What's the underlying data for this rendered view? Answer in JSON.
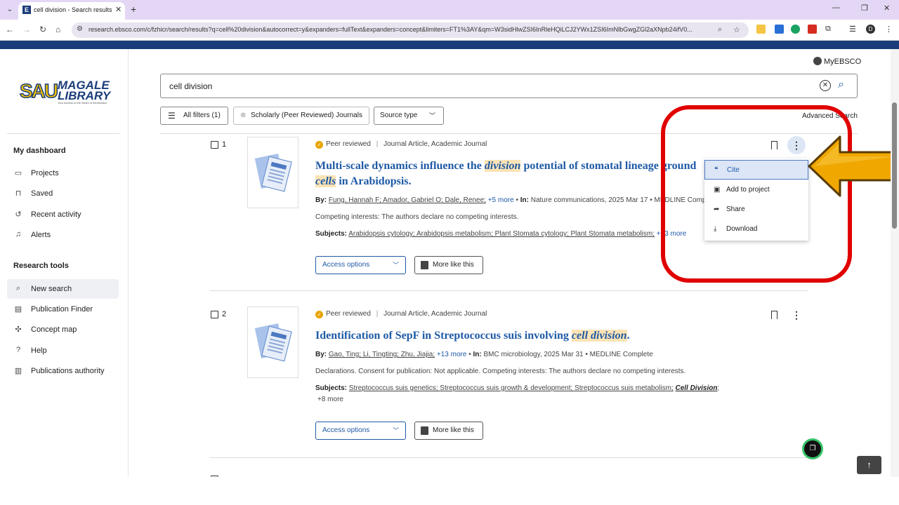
{
  "browser": {
    "tab_title": "cell division - Search results - E",
    "tab_favicon": "E",
    "url": "research.ebsco.com/c/fzhicr/search/results?q=cell%20division&autocorrect=y&expanders=fullText&expanders=concept&limiters=FT1%3AY&qm=W3sidHlwZSI6InRleHQiLCJ2YWx1ZSI6ImNlbGwgZGl2aXNpb24ifV0...",
    "profile_initial": "D"
  },
  "sidebar": {
    "logo_sau": "SAU",
    "logo_top": "MAGALE",
    "logo_bottom": "LIBRARY",
    "logo_tagline": "Your Access to the World of Information",
    "dashboard_heading": "My dashboard",
    "dashboard_items": [
      {
        "label": "Projects",
        "icon": "folder-icon"
      },
      {
        "label": "Saved",
        "icon": "bookmark-icon"
      },
      {
        "label": "Recent activity",
        "icon": "history-icon"
      },
      {
        "label": "Alerts",
        "icon": "bell-icon"
      }
    ],
    "tools_heading": "Research tools",
    "tools_items": [
      {
        "label": "New search",
        "icon": "search-icon"
      },
      {
        "label": "Publication Finder",
        "icon": "document-icon"
      },
      {
        "label": "Concept map",
        "icon": "network-icon"
      },
      {
        "label": "Help",
        "icon": "help-icon"
      },
      {
        "label": "Publications authority",
        "icon": "book-icon"
      }
    ]
  },
  "header": {
    "myebsco": "MyEBSCO",
    "search_value": "cell division",
    "filters": {
      "all_filters": "All filters (1)",
      "scholarly": "Scholarly (Peer Reviewed) Journals",
      "source_type": "Source type"
    },
    "advanced_search": "Advanced Search"
  },
  "results": [
    {
      "num": "1",
      "peer": "Peer reviewed",
      "type": "Journal Article, Academic Journal",
      "title_pre": "Multi-scale dynamics influence the ",
      "title_hl1": "division",
      "title_mid": " potential of stomatal lineage ground ",
      "title_hl2": "cells",
      "title_post": " in Arabidopsis.",
      "by_label": "By:",
      "authors": "Fung, Hannah F; Amador, Gabriel O; Dale, Renee;",
      "more_authors": "+5 more",
      "in_label": "In:",
      "source": "Nature communications, 2025 Mar 17 • MEDLINE Complete",
      "note": "Competing interests: The authors declare no competing interests.",
      "subjects_label": "Subjects:",
      "subjects": "Arabidopsis cytology; Arabidopsis metabolism; Plant Stomata cytology; Plant Stomata metabolism;",
      "more_subjects": "+13 more",
      "access": "Access options",
      "more_like": "More like this"
    },
    {
      "num": "2",
      "peer": "Peer reviewed",
      "type": "Journal Article, Academic Journal",
      "title_pre": "Identification of SepF in Streptococcus suis involving ",
      "title_hl1": "cell division",
      "title_post": ".",
      "by_label": "By:",
      "authors": "Gao, Ting; Li, Tingting; Zhu, Jiajia;",
      "more_authors": "+13 more",
      "in_label": "In:",
      "source": "BMC microbiology, 2025 Mar 31 • MEDLINE Complete",
      "note": "Declarations. Consent for publication: Not applicable. Competing interests: The authors declare no competing interests.",
      "subjects_label": "Subjects:",
      "subjects": "Streptococcus suis genetics; Streptococcus suis growth & development; Streptococcus suis metabolism;",
      "subjects_em": "Cell Division",
      "more_subjects": "+8 more",
      "access": "Access options",
      "more_like": "More like this"
    }
  ],
  "menu": {
    "items": [
      {
        "label": "Cite",
        "icon": "quote-icon",
        "glyph": "❝"
      },
      {
        "label": "Add to project",
        "icon": "folder-plus-icon",
        "glyph": "▣"
      },
      {
        "label": "Share",
        "icon": "share-icon",
        "glyph": "➦"
      },
      {
        "label": "Download",
        "icon": "download-icon",
        "glyph": "⤓"
      }
    ]
  },
  "colors": {
    "brand_navy": "#1b3c7a",
    "link_blue": "#1f5aa6",
    "highlight": "#fbe3b5",
    "annotation_red": "#e00000",
    "annotation_arrow": "#f0a800"
  }
}
